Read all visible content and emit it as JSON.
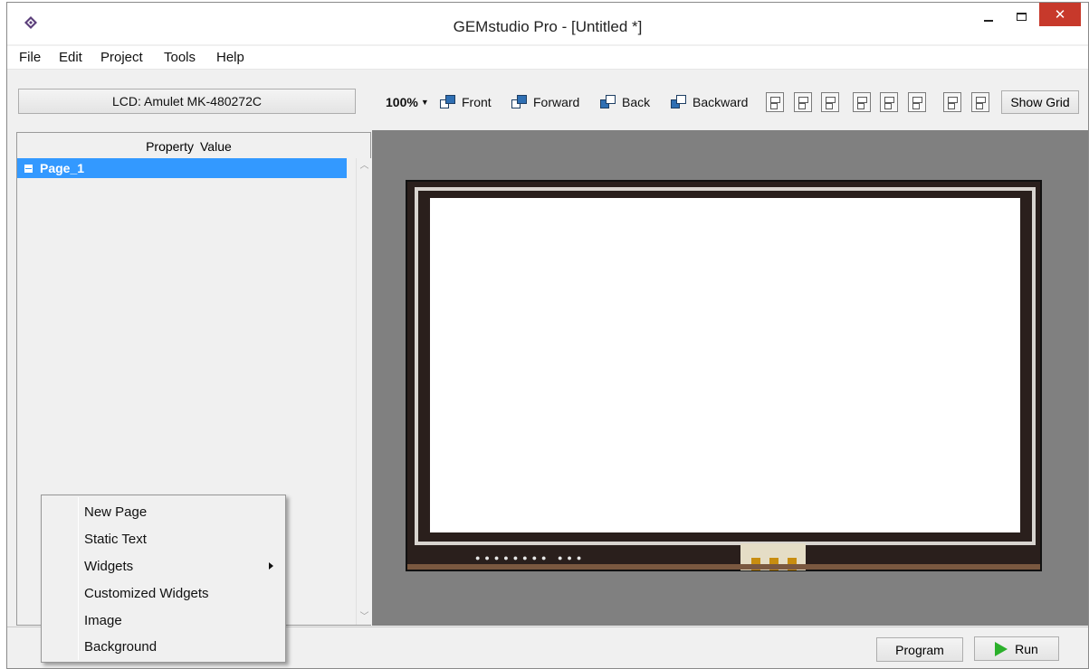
{
  "window": {
    "title": "GEMstudio Pro - [Untitled *]",
    "close_glyph": "✕"
  },
  "menu": {
    "items": [
      "File",
      "Edit",
      "Project",
      "Tools",
      "Help"
    ]
  },
  "toolbar": {
    "lcd_label": "LCD: Amulet MK-480272C",
    "zoom": "100%",
    "front_label": "Front",
    "forward_label": "Forward",
    "back_label": "Back",
    "backward_label": "Backward",
    "show_grid_label": "Show Grid"
  },
  "property_panel": {
    "header_property": "Property",
    "header_value": "Value",
    "tree_item": "Page_1"
  },
  "status_bar": {
    "program_label": "Program",
    "run_label": "Run"
  },
  "context_menu": {
    "items": [
      "New Page",
      "Static Text",
      "Widgets",
      "Customized Widgets",
      "Image",
      "Background"
    ]
  },
  "colors": {
    "selection": "#3399ff",
    "close_button": "#c7392b",
    "canvas_bg": "#808080",
    "run_icon": "#2bb02b"
  }
}
